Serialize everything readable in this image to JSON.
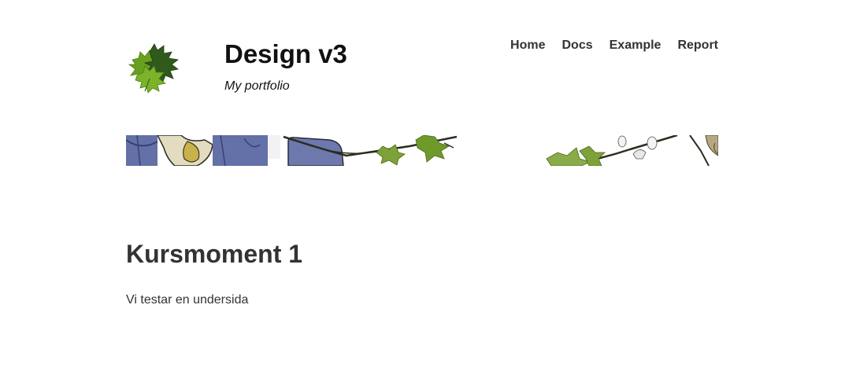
{
  "header": {
    "title": "Design v3",
    "slogan": "My portfolio",
    "logo_icon": "maple-leaf-icon"
  },
  "navbar": {
    "items": [
      {
        "label": "Home"
      },
      {
        "label": "Docs"
      },
      {
        "label": "Example"
      },
      {
        "label": "Report"
      }
    ]
  },
  "banner": {
    "image": "illustrated-branches-leaves-banner"
  },
  "main": {
    "heading": "Kursmoment 1",
    "text": "Vi testar en undersida"
  },
  "colors": {
    "text": "#333333",
    "title": "#111111",
    "leaf_light": "#6aa01f",
    "leaf_dark": "#2f5a1c",
    "banner_blue": "#6470a8"
  }
}
